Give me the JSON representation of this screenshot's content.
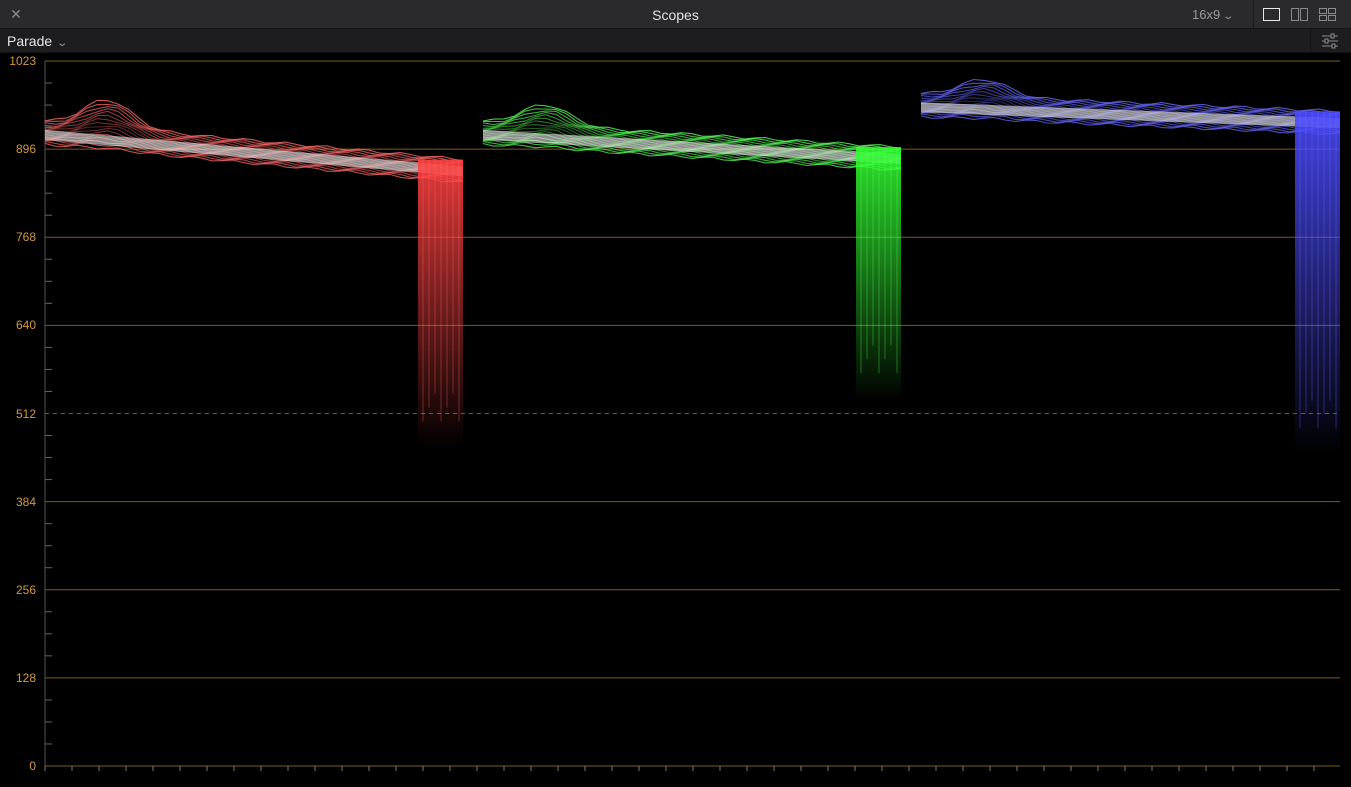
{
  "window": {
    "title": "Scopes",
    "close_glyph": "✕",
    "aspect_label": "16x9",
    "aspect_chevron": "⌄"
  },
  "toolbar": {
    "mode_label": "Parade",
    "mode_chevron": "⌄"
  },
  "scope": {
    "axis_labels": [
      "1023",
      "896",
      "768",
      "640",
      "512",
      "384",
      "256",
      "128",
      "0"
    ],
    "colors": {
      "gridline": "#7a5a22",
      "label": "#d49a3a",
      "red_channel": "#ff6a6a",
      "green_channel": "#5cff5c",
      "blue_channel": "#6a6aff"
    }
  },
  "icons": {
    "close": "close-icon",
    "aspect_dropdown": "chevron-down-icon",
    "single_view": "single-view-icon",
    "dual_view": "dual-view-icon",
    "quad_view": "quad-view-icon",
    "settings": "sliders-icon"
  }
}
